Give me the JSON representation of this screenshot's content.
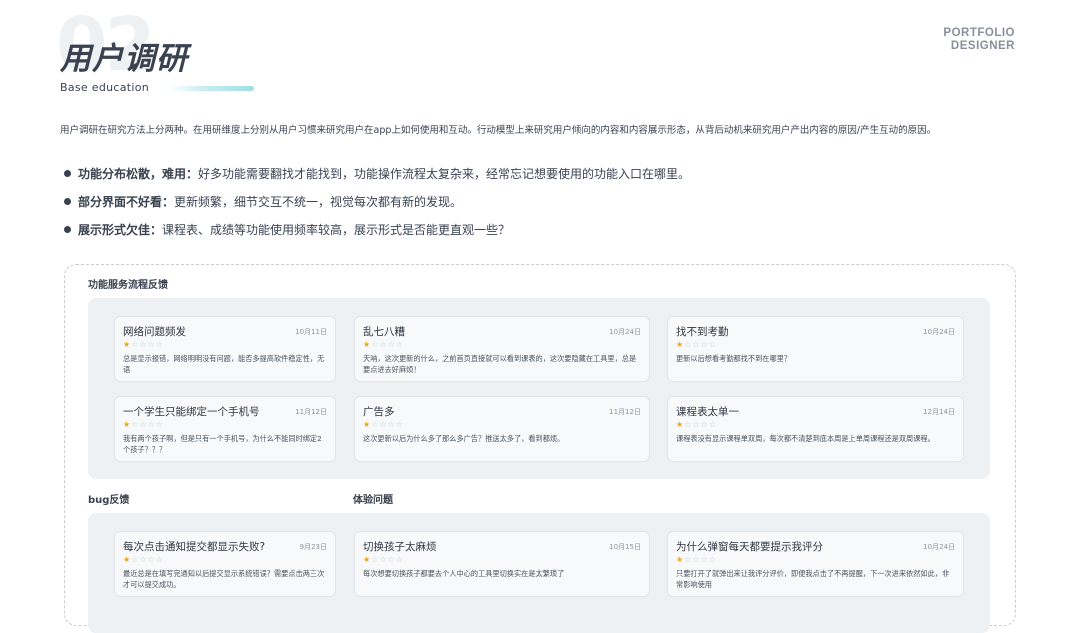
{
  "header": {
    "big_number": "02",
    "title": "用户调研",
    "subtitle": "Base  education",
    "brand_line1": "PORTFOLIO",
    "brand_line2": "DESIGNER"
  },
  "intro": "用户调研在研究方法上分两种。在用研维度上分别从用户习惯来研究用户在app上如何使用和互动。行动模型上来研究用户倾向的内容和内容展示形态，从背后动机来研究用户产出内容的原因/产生互动的原因。",
  "bullets": [
    {
      "bold": "功能分布松散，难用：",
      "text": "好多功能需要翻找才能找到，功能操作流程太复杂来，经常忘记想要使用的功能入口在哪里。"
    },
    {
      "bold": "部分界面不好看：",
      "text": "更新频繁，细节交互不统一，视觉每次都有新的发现。"
    },
    {
      "bold": "展示形式欠佳：",
      "text": "课程表、成绩等功能使用频率较高，展示形式是否能更直观一些？"
    }
  ],
  "sections": {
    "flow": "功能服务流程反馈",
    "bug": "bug反馈",
    "experience": "体验问题"
  },
  "cards": [
    {
      "title": "网络问题频发",
      "date": "10月11日",
      "rating": 1,
      "body": "总是显示报错，网络明明没有问题，能否多提高软件稳定性，无语"
    },
    {
      "title": "乱七八糟",
      "date": "10月24日",
      "rating": 1,
      "body": "天呐，这次更新的什么，之前首页直接就可以看到课表的，这次要隐藏在工具里，总是要点进去好麻烦！"
    },
    {
      "title": "找不到考勤",
      "date": "10月24日",
      "rating": 1,
      "body": "更新以后想看考勤都找不到在哪里？"
    },
    {
      "title": "一个学生只能绑定一个手机号",
      "date": "11月12日",
      "rating": 1,
      "body": "我有两个孩子啊，但是只有一个手机号，为什么不能同时绑定2个孩子？？？"
    },
    {
      "title": "广告多",
      "date": "11月12日",
      "rating": 1,
      "body": "这次更新以后为什么多了那么多广告？推送太多了，看到都烦。"
    },
    {
      "title": "课程表太单一",
      "date": "12月14日",
      "rating": 1,
      "body": "课程表没有显示课程单双周，每次都不清楚到底本周是上单周课程还是双周课程。"
    },
    {
      "title": "每次点击通知提交都显示失败?",
      "date": "9月23日",
      "rating": 1,
      "body": "最近总是在填写完通知以后提交显示系统错误？需要点击两三次才可以提交成功。"
    },
    {
      "title": "切换孩子太麻烦",
      "date": "10月15日",
      "rating": 1,
      "body": "每次想要切换孩子都要去个人中心的工具里切换实在是太繁琐了"
    },
    {
      "title": "为什么弹窗每天都要提示我评分",
      "date": "10月24日",
      "rating": 1,
      "body": "只要打开了就弹出来让我评分评价，即便我点击了不再提醒，下一次进来依然如此，非常影响使用"
    }
  ],
  "colors": {
    "star_on": "#f0a21b",
    "star_off": "#c9ced3",
    "accent": "#9fdde3"
  }
}
